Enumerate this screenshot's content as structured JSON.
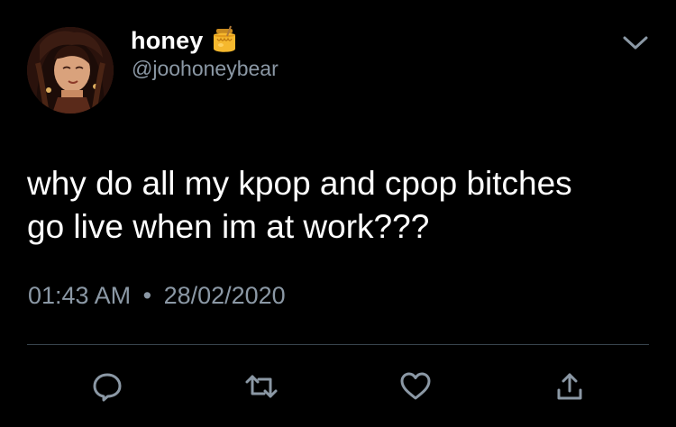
{
  "user": {
    "display_name": "honey",
    "handle": "@joohoneybear",
    "name_emoji": "honey-pot-icon"
  },
  "tweet": {
    "text": "why do all my kpop and cpop bitches\ngo live when im at work???",
    "time": "01:43 AM",
    "separator": "•",
    "date": "28/02/2020"
  },
  "actions": [
    "reply-icon",
    "retweet-icon",
    "like-icon",
    "share-icon"
  ],
  "colors": {
    "background": "#000000",
    "primary_text": "#ffffff",
    "secondary_text": "#8b98a5",
    "divider": "#38444d",
    "icon": "#8b98a5",
    "honey": "#f5b82e"
  }
}
